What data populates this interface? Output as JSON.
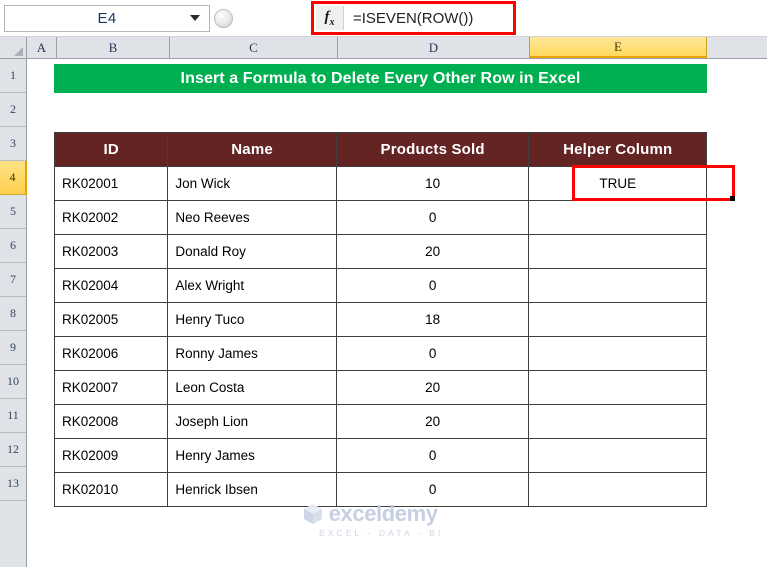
{
  "formula_bar": {
    "name_box_value": "E4",
    "name_box_dropdown_icon": "chevron-down-icon",
    "fx_label": "fx",
    "formula_value": "=ISEVEN(ROW())",
    "selection_border_color": "#FF0000"
  },
  "columns": {
    "corner_icon": "select-all-icon",
    "headers": [
      "A",
      "B",
      "C",
      "D",
      "E"
    ],
    "selected": "E",
    "selected_highlight_color": "#FFD95C"
  },
  "rows": {
    "headers": [
      "1",
      "2",
      "3",
      "4",
      "5",
      "6",
      "7",
      "8",
      "9",
      "10",
      "11",
      "12",
      "13"
    ],
    "selected": "4"
  },
  "sheet": {
    "title_banner": {
      "text": "Insert a Formula to Delete Every Other Row in Excel",
      "background": "#00B050",
      "text_color": "#FFFFFF"
    },
    "table": {
      "header_background": "#632423",
      "header_text_color": "#FFFFFF",
      "headers": [
        "ID",
        "Name",
        "Products Sold",
        "Helper Column"
      ],
      "rows": [
        {
          "id": "RK02001",
          "name": "Jon Wick",
          "products_sold": "10",
          "helper": "TRUE"
        },
        {
          "id": "RK02002",
          "name": "Neo Reeves",
          "products_sold": "0",
          "helper": ""
        },
        {
          "id": "RK02003",
          "name": "Donald Roy",
          "products_sold": "20",
          "helper": ""
        },
        {
          "id": "RK02004",
          "name": "Alex Wright",
          "products_sold": "0",
          "helper": ""
        },
        {
          "id": "RK02005",
          "name": "Henry Tuco",
          "products_sold": "18",
          "helper": ""
        },
        {
          "id": "RK02006",
          "name": "Ronny James",
          "products_sold": "0",
          "helper": ""
        },
        {
          "id": "RK02007",
          "name": "Leon Costa",
          "products_sold": "20",
          "helper": ""
        },
        {
          "id": "RK02008",
          "name": "Joseph Lion",
          "products_sold": "20",
          "helper": ""
        },
        {
          "id": "RK02009",
          "name": "Henry James",
          "products_sold": "0",
          "helper": ""
        },
        {
          "id": "RK02010",
          "name": "Henrick Ibsen",
          "products_sold": "0",
          "helper": ""
        }
      ]
    },
    "active_cell": {
      "reference": "E4",
      "displayed_value": "TRUE",
      "highlight_color": "#FF0000"
    }
  },
  "watermark": {
    "logo_icon": "cube-logo-icon",
    "name": "exceldemy",
    "tagline": "EXCEL - DATA - BI"
  }
}
